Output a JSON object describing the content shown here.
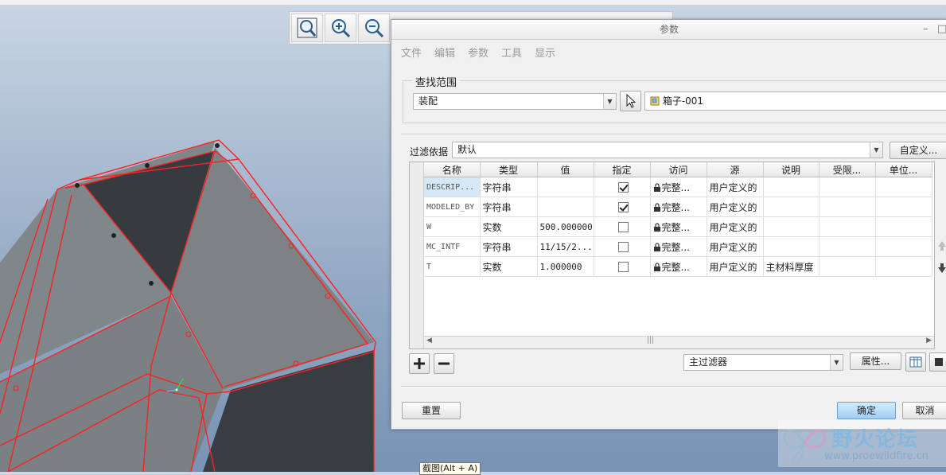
{
  "toolbar": {
    "icons": [
      "zoom-window-icon",
      "zoom-in-icon",
      "zoom-out-icon"
    ]
  },
  "dialog": {
    "title": "参数",
    "window_controls": {
      "minimize": "–",
      "maximize": "□"
    },
    "menu": [
      "文件",
      "编辑",
      "参数",
      "工具",
      "显示"
    ],
    "search_scope": {
      "label": "查找范围",
      "scope_value": "装配",
      "object_value": "箱子-001"
    },
    "filter": {
      "label": "过滤依据",
      "value": "默认",
      "customize_label": "自定义..."
    },
    "table": {
      "columns": [
        "名称",
        "类型",
        "值",
        "指定",
        "访问",
        "源",
        "说明",
        "受限...",
        "单位..."
      ],
      "rows": [
        {
          "name": "DESCRIP...",
          "type": "字符串",
          "value": "",
          "designated": true,
          "access": "完整...",
          "source": "用户定义的",
          "description": "",
          "restricted": "",
          "units": ""
        },
        {
          "name": "MODELED_BY",
          "type": "字符串",
          "value": "",
          "designated": true,
          "access": "完整...",
          "source": "用户定义的",
          "description": "",
          "restricted": "",
          "units": ""
        },
        {
          "name": "W",
          "type": "实数",
          "value": "500.000000",
          "designated": false,
          "access": "完整...",
          "source": "用户定义的",
          "description": "",
          "restricted": "",
          "units": ""
        },
        {
          "name": "MC_INTF",
          "type": "字符串",
          "value": "11/15/2...",
          "designated": false,
          "access": "完整...",
          "source": "用户定义的",
          "description": "",
          "restricted": "",
          "units": ""
        },
        {
          "name": "T",
          "type": "实数",
          "value": "1.000000",
          "designated": false,
          "access": "完整...",
          "source": "用户定义的",
          "description": "主材料厚度",
          "restricted": "",
          "units": ""
        }
      ],
      "scroll_grip": "|||"
    },
    "bottom_filter": {
      "value": "主过滤器"
    },
    "properties_label": "属性...",
    "buttons": {
      "reset": "重置",
      "ok": "确定",
      "cancel": "取消"
    }
  },
  "tooltip": "截图(Alt + A)",
  "watermark": {
    "title": "野火论坛",
    "url": "www.proewildfire.cn"
  },
  "colors": {
    "model_edge": "#ff2020",
    "model_face": "#7c8183",
    "model_dark": "#34393e",
    "primary_button": "#9fcdf3"
  }
}
